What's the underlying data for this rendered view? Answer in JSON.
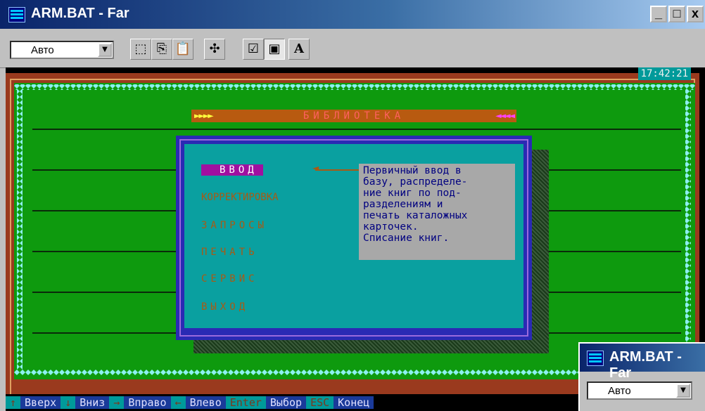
{
  "window": {
    "title": "ARM.BAT - Far"
  },
  "window_buttons": {
    "minimize": "_",
    "maximize": "□",
    "close": "x"
  },
  "toolbar": {
    "font_select": "Авто",
    "icons": [
      "marquee-select-icon",
      "copy-icon",
      "paste-icon",
      "fullscreen-icon",
      "properties-icon",
      "background-icon",
      "font-icon"
    ]
  },
  "console": {
    "clock": "17:42:21",
    "banner": {
      "left_arrows": "►►►►",
      "title": "БИБЛИОТЕКА",
      "right_arrows": "◄◄◄◄"
    },
    "menu": [
      {
        "label": "ВВОД",
        "selected": true
      },
      {
        "label": "КОРРЕКТИРОВКА"
      },
      {
        "label": "ЗАПРОСЫ"
      },
      {
        "label": "ПЕЧАТЬ"
      },
      {
        "label": "СЕРВИС"
      },
      {
        "label": "ВЫХОД"
      }
    ],
    "description": "Первичный ввод в\nбазу, распределе-\nние книг по под-\nразделениям и\nпечать каталожных\nкарточек.\nСписание книг."
  },
  "status_bar": [
    {
      "key": "↑",
      "label": "Вверх"
    },
    {
      "key": "↓",
      "label": "Вниз"
    },
    {
      "key": "→",
      "label": "Вправо"
    },
    {
      "key": "←",
      "label": "Влево"
    },
    {
      "key": "Enter",
      "label": "Выбор"
    },
    {
      "key": "ESC",
      "label": "Конец"
    }
  ],
  "second_window": {
    "title": "ARM.BAT - Far",
    "font_select": "Авто"
  }
}
